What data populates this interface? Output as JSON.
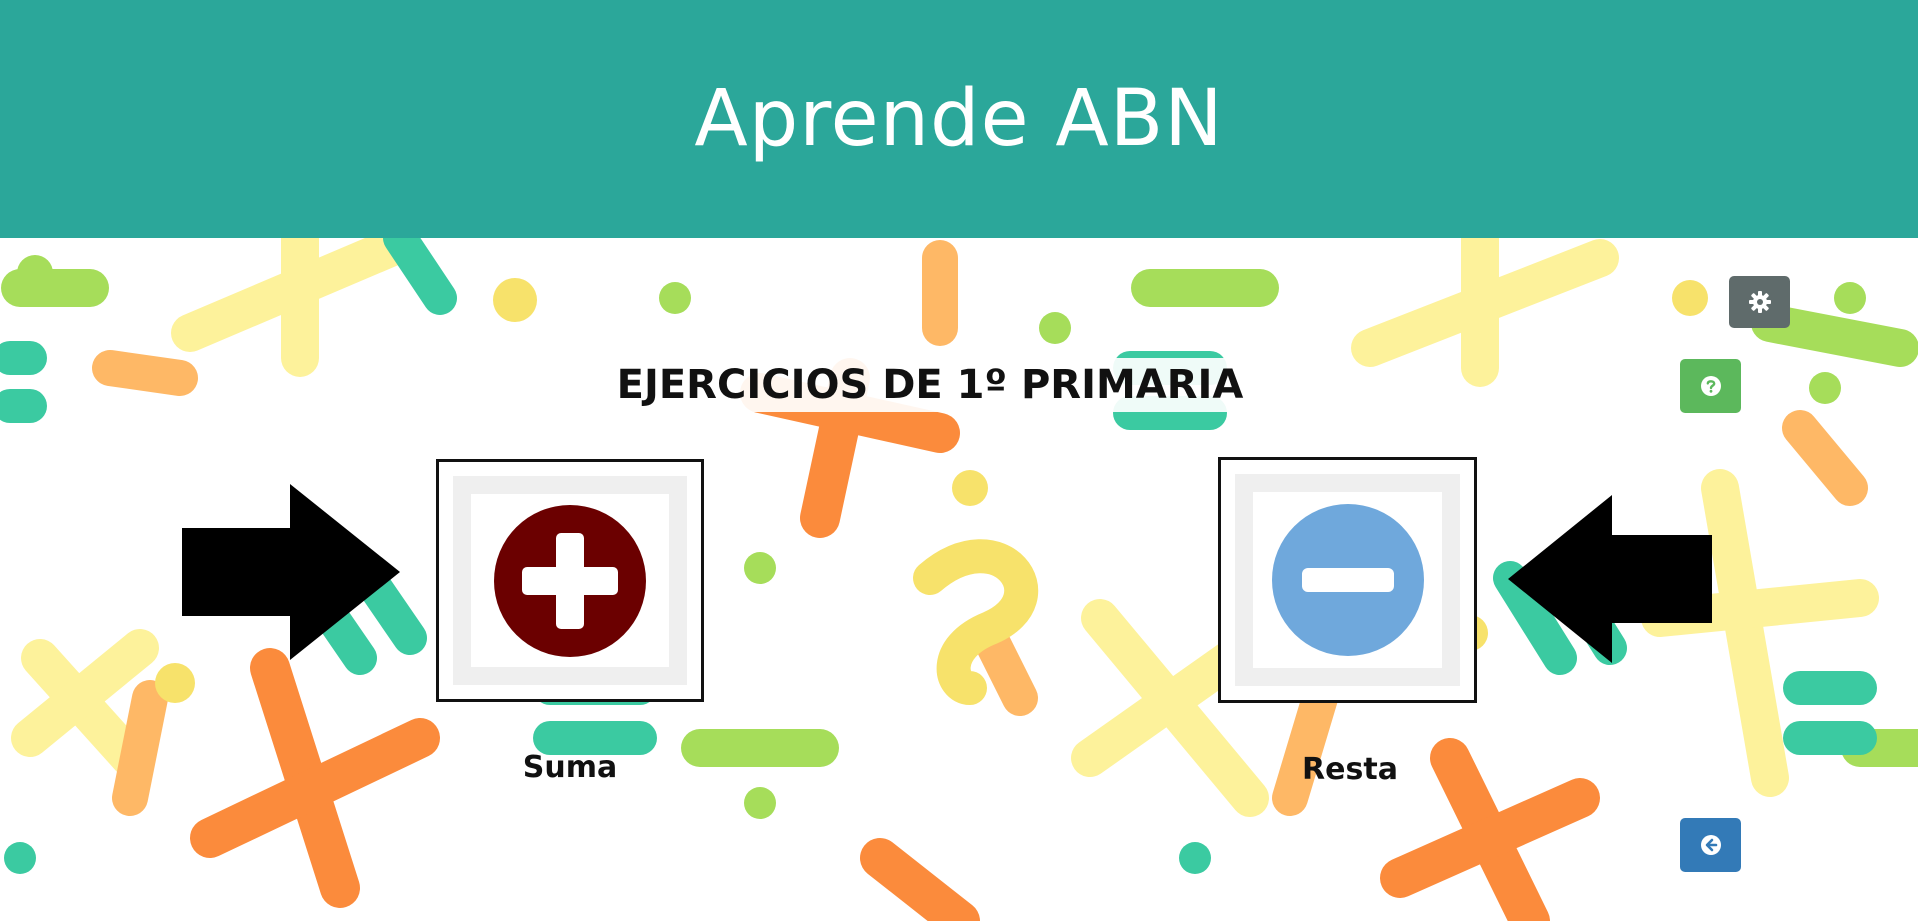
{
  "header": {
    "title": "Aprende ABN"
  },
  "main": {
    "section_title": "EJERCICIOS DE 1º PRIMARIA",
    "operations": [
      {
        "label": "Suma",
        "icon": "plus-circle-icon",
        "color": "#6b0000"
      },
      {
        "label": "Resta",
        "icon": "minus-circle-icon",
        "color": "#6fa8dc"
      }
    ]
  },
  "toolbar": {
    "settings_icon": "gear-icon",
    "help_icon": "question-circle-icon",
    "back_icon": "arrow-left-circle-icon"
  },
  "colors": {
    "header_bg": "#2ba79a",
    "settings_bg": "#5f6b6b",
    "help_bg": "#5cb85c",
    "back_bg": "#337ab7"
  }
}
